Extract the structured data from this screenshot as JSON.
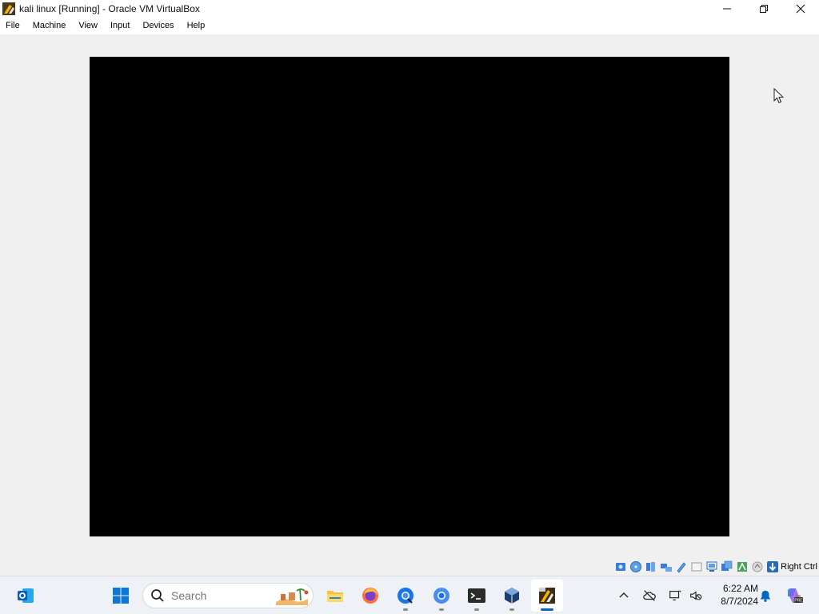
{
  "window": {
    "title": "kali linux [Running] - Oracle VM VirtualBox",
    "minimize_icon": "minimize-icon",
    "restore_icon": "restore-icon",
    "close_icon": "close-icon"
  },
  "menu": {
    "items": [
      {
        "label": "File"
      },
      {
        "label": "Machine"
      },
      {
        "label": "View"
      },
      {
        "label": "Input"
      },
      {
        "label": "Devices"
      },
      {
        "label": "Help"
      }
    ]
  },
  "vm": {
    "screen_color": "#000000",
    "background_color": "#f0f0f0"
  },
  "statusbar": {
    "icons": [
      "hard-disk-icon",
      "optical-drive-icon",
      "audio-icon",
      "network-icon",
      "usb-icon",
      "shared-folders-icon",
      "display-icon",
      "recording-icon",
      "cpu-icon",
      "mouse-integration-icon",
      "host-key-arrow-icon"
    ],
    "host_key": "Right Ctrl"
  },
  "taskbar": {
    "search_placeholder": "Search",
    "apps": [
      "outlook-icon",
      "start-icon",
      "file-explorer-icon",
      "firefox-icon",
      "chrome-beta-icon",
      "chrome-icon",
      "terminal-icon",
      "virtualbox-icon",
      "kali-vm-icon"
    ],
    "clock_time": "6:22 AM",
    "clock_date": "8/7/2024",
    "accent": "#0067c0"
  }
}
